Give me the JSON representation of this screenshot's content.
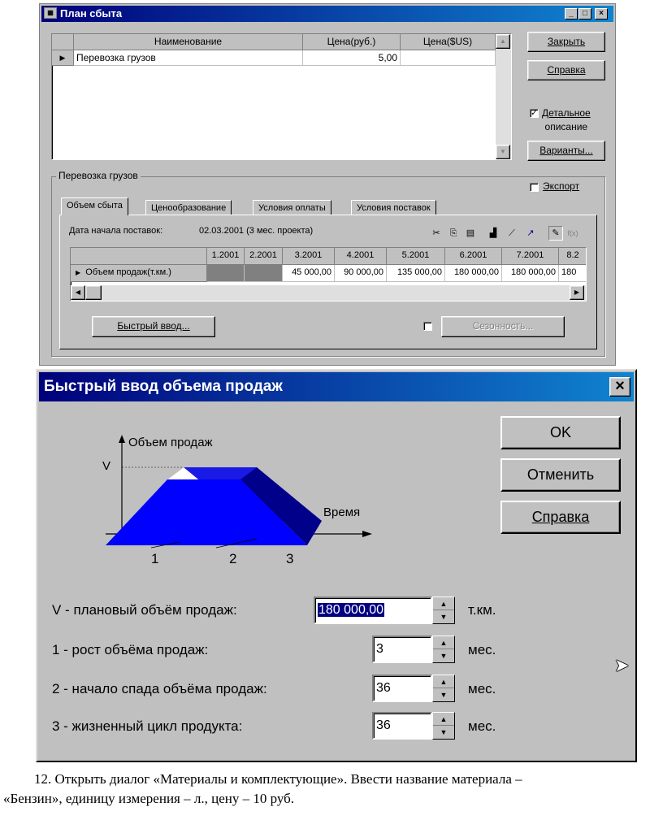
{
  "plan_window": {
    "title": "План сбыта",
    "table": {
      "columns": [
        "Наименование",
        "Цена(руб.)",
        "Цена($US)"
      ],
      "rows": [
        {
          "name": "Перевозка грузов",
          "price_rub": "5,00",
          "price_usd": ""
        }
      ]
    },
    "buttons": {
      "close": "Закрыть",
      "help": "Справка",
      "variants": "Варианты..."
    },
    "detail_checkbox": {
      "label_line1": "Детальное",
      "label_line2": "описание"
    },
    "group_title": "Перевозка грузов",
    "export_label": "Экспорт",
    "tabs": [
      "Объем сбыта",
      "Ценообразование",
      "Условия оплаты",
      "Условия поставок"
    ],
    "start_date_label": "Дата начала поставок:",
    "start_date_value": "02.03.2001 (3 мес. проекта)",
    "grid": {
      "months": [
        "1.2001",
        "2.2001",
        "3.2001",
        "4.2001",
        "5.2001",
        "6.2001",
        "7.2001",
        "8.2"
      ],
      "row_label": "Объем продаж(т.км.)",
      "values": [
        "",
        "",
        "45 000,00",
        "90 000,00",
        "135 000,00",
        "180 000,00",
        "180 000,00",
        "180"
      ]
    },
    "quick_input_button": "Быстрый ввод...",
    "seasonality_button": "Сезонность..."
  },
  "quick_dialog": {
    "title": "Быстрый ввод объема продаж",
    "ok": "OK",
    "cancel": "Отменить",
    "help": "Справка",
    "diagram": {
      "y_label": "Объем продаж",
      "x_label": "Время",
      "v_label": "V",
      "ticks": [
        "1",
        "2",
        "3"
      ]
    },
    "fields": [
      {
        "label": "V - плановый объём продаж:",
        "value": "180 000,00",
        "unit": "т.км."
      },
      {
        "label": "1 - рост объёма продаж:",
        "value": "3",
        "unit": "мес."
      },
      {
        "label": "2 - начало спада объёма продаж:",
        "value": "36",
        "unit": "мес."
      },
      {
        "label": "3 - жизненный цикл продукта:",
        "value": "36",
        "unit": "мес."
      }
    ]
  },
  "caption": {
    "line1": "12. Открыть диалог «Материалы и комплектующие». Ввести название материала –",
    "line2": "«Бензин», единицу измерения  – л., цену – 10 руб."
  }
}
